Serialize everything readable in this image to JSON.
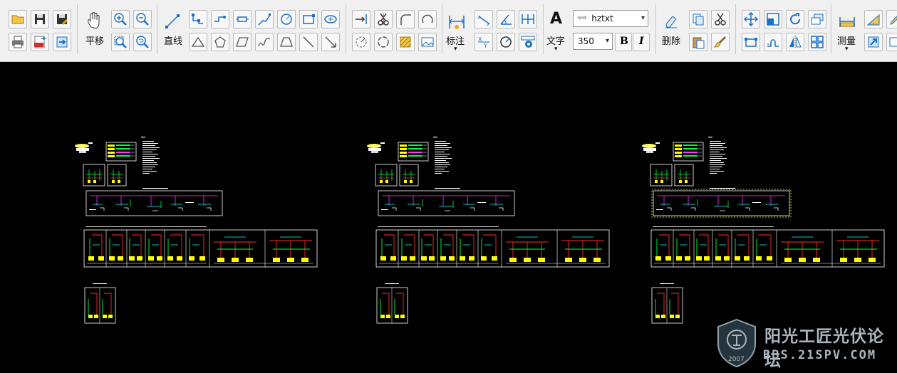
{
  "toolbar": {
    "pan_label": "平移",
    "line_label": "直线",
    "dimension_label": "标注",
    "text_label": "文字",
    "text_icon_glyph": "A",
    "font_combo_value": "hztxt",
    "font_combo_prefix": "SHX",
    "size_combo_value": "350",
    "bold_label": "B",
    "italic_label": "I",
    "delete_label": "删除",
    "measure_label": "测量",
    "dropdown_glyph": "▾"
  },
  "watermark": {
    "title": "阳光工匠光伏论坛",
    "subtitle": "BBS.21SPV.COM",
    "year": "2007"
  },
  "colors": {
    "canvas_bg": "#000000",
    "toolbar_bg": "#f0f0f0",
    "icon_blue": "#1a6fc9",
    "cad_white": "#ffffff",
    "cad_red": "#ff2a2a",
    "cad_green": "#00ff44",
    "cad_yellow": "#ffff00",
    "cad_cyan": "#00ffff",
    "cad_magenta": "#ff33ff"
  }
}
